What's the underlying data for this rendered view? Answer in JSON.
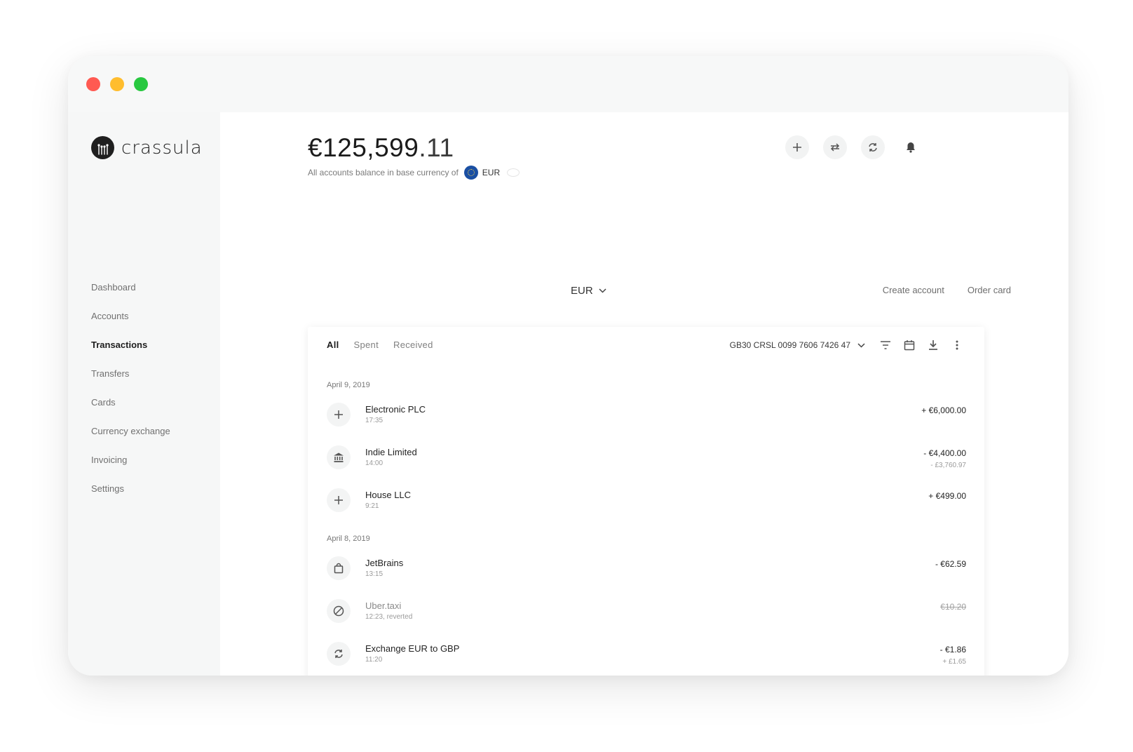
{
  "app": {
    "brand": "crassula"
  },
  "window_controls": [
    "close",
    "minimize",
    "maximize"
  ],
  "sidebar": {
    "items": [
      {
        "label": "Dashboard"
      },
      {
        "label": "Accounts"
      },
      {
        "label": "Transactions",
        "active": true
      },
      {
        "label": "Transfers"
      },
      {
        "label": "Cards"
      },
      {
        "label": "Currency exchange"
      },
      {
        "label": "Invoicing"
      },
      {
        "label": "Settings"
      }
    ]
  },
  "balance": {
    "whole": "€125,599",
    "cents": ".11",
    "caption": "All accounts balance in base currency of",
    "currency": "EUR"
  },
  "header_actions": [
    {
      "icon": "plus-icon"
    },
    {
      "icon": "transfer-arrows-icon"
    },
    {
      "icon": "exchange-icon"
    },
    {
      "icon": "bell-icon"
    }
  ],
  "currency_selector": {
    "value": "EUR"
  },
  "links": {
    "create_account": "Create account",
    "order_card": "Order card"
  },
  "transactions": {
    "tabs": [
      {
        "label": "All",
        "active": true
      },
      {
        "label": "Spent"
      },
      {
        "label": "Received"
      }
    ],
    "account_iban": "GB30 CRSL 0099 7606 7426 47",
    "groups": [
      {
        "date": "April 9, 2019",
        "items": [
          {
            "name": "Electronic PLC",
            "time": "17:35",
            "amount": "+ €6,000.00",
            "sub_amount": "",
            "icon": "plus-icon"
          },
          {
            "name": "Indie Limited",
            "time": "14:00",
            "amount": "- €4,400.00",
            "sub_amount": "- £3,760.97",
            "icon": "bank-icon"
          },
          {
            "name": "House LLC",
            "time": "9:21",
            "amount": "+ €499.00",
            "sub_amount": "",
            "icon": "plus-icon"
          }
        ]
      },
      {
        "date": "April 8, 2019",
        "items": [
          {
            "name": "JetBrains",
            "time": "13:15",
            "amount": "- €62.59",
            "sub_amount": "",
            "icon": "shopping-bag-icon"
          },
          {
            "name": "Uber.taxi",
            "time": "12:23, reverted",
            "amount": "€10.20",
            "sub_amount": "",
            "icon": "blocked-icon",
            "reverted": true
          },
          {
            "name": "Exchange EUR to GBP",
            "time": "11:20",
            "amount": "- €1.86",
            "sub_amount": "+ £1.65",
            "icon": "exchange-icon"
          }
        ]
      }
    ]
  },
  "colors": {
    "close": "#ff5a52",
    "minimize": "#ffbd2e",
    "maximize": "#28c840",
    "eur_flag": "#1a4fa3"
  }
}
